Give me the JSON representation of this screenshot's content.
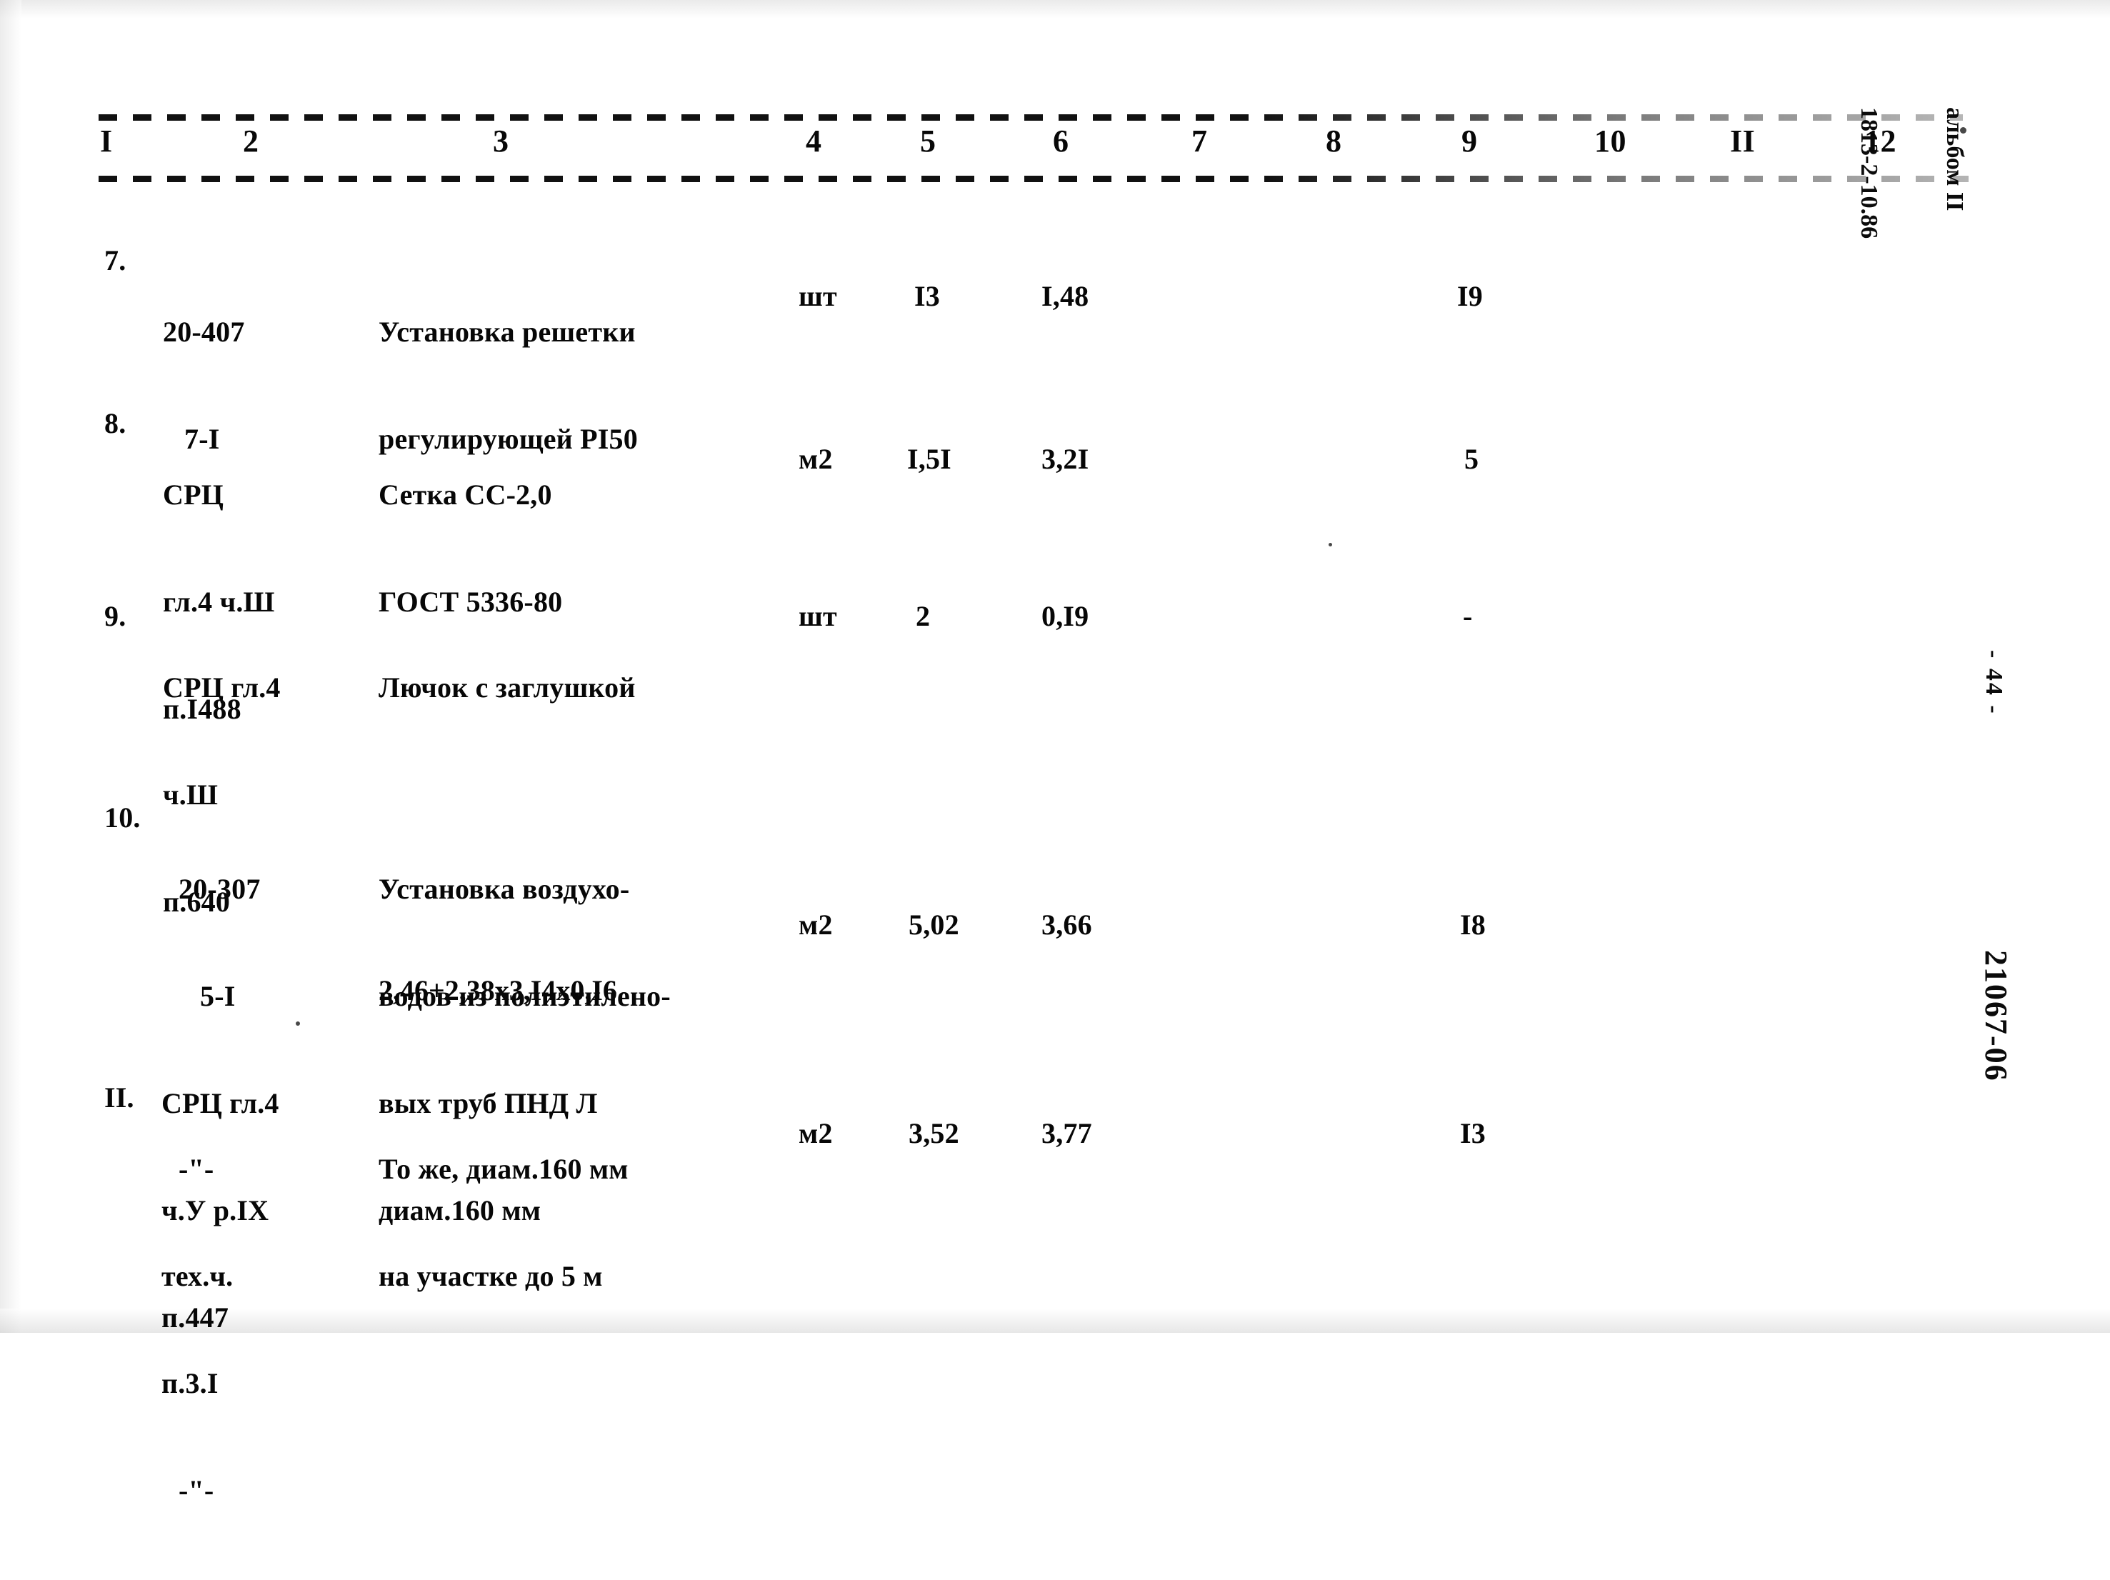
{
  "document": {
    "type": "scanned-estimate-table",
    "language": "ru",
    "album_note_line1": "альбом II",
    "album_note_line2": "1813-2-10.86",
    "page_number": "- 44 -",
    "doc_code": "21067-06"
  },
  "table": {
    "column_headers": [
      "I",
      "2",
      "3",
      "4",
      "5",
      "6",
      "7",
      "8",
      "9",
      "10",
      "II",
      "12"
    ],
    "rows": [
      {
        "num": "7.",
        "code_lines": [
          "20-407",
          "7-I"
        ],
        "description_lines": [
          "Установка решетки",
          "регулирующей РI50"
        ],
        "unit": "шт",
        "col5": "I3",
        "col6": "I,48",
        "col7": "",
        "col8": "",
        "col9": "I9",
        "col10": "",
        "col11": "",
        "col12": ""
      },
      {
        "num": "8.",
        "code_lines": [
          "СРЦ",
          "гл.4 ч.Ш",
          "п.I488"
        ],
        "description_lines": [
          "Сетка СС-2,0",
          "ГОСТ 5336-80"
        ],
        "unit": "м2",
        "col5": "I,5I",
        "col6": "3,2I",
        "col7": "",
        "col8": "",
        "col9": "5",
        "col10": "",
        "col11": "",
        "col12": ""
      },
      {
        "num": "9.",
        "code_lines": [
          "СРЦ гл.4",
          "ч.Ш",
          "п.640"
        ],
        "description_lines": [
          "Лючок с заглушкой"
        ],
        "unit": "шт",
        "col5": "2",
        "col6": "0,I9",
        "col7": "",
        "col8": "",
        "col9": "-",
        "col10": "",
        "col11": "",
        "col12": ""
      },
      {
        "num": "10.",
        "code_lines": [
          "20-307",
          "5-I",
          "СРЦ гл.4",
          "ч.У р.IX",
          "п.447"
        ],
        "description_lines": [
          "Установка воздухо-",
          "водов из полиэтилено-",
          "вых труб ПНД Л",
          "диам.160 мм"
        ],
        "formula": "2,46+2,38х3,I4х0,I6",
        "unit": "м2",
        "col5": "5,02",
        "col6": "3,66",
        "col7": "",
        "col8": "",
        "col9": "I8",
        "col10": "",
        "col11": "",
        "col12": ""
      },
      {
        "num": "II.",
        "code_lines": [
          "-\"-",
          "тех.ч.",
          "п.3.I",
          "-\"-"
        ],
        "description_lines": [
          "То же, диам.160 мм",
          "на участке до 5 м"
        ],
        "unit": "м2",
        "col5": "3,52",
        "col6": "3,77",
        "col7": "",
        "col8": "",
        "col9": "I3",
        "col10": "",
        "col11": "",
        "col12": ""
      }
    ]
  }
}
